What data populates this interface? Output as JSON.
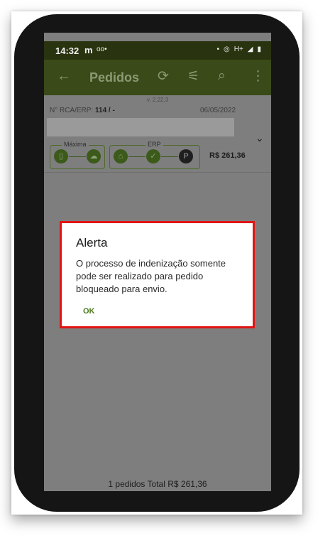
{
  "statusbar": {
    "time": "14:32",
    "carrier_icon": "m",
    "voicemail_icon": "oo•",
    "network": "H+"
  },
  "appbar": {
    "title": "Pedidos",
    "back_icon": "←",
    "sync_icon": "⟳",
    "filter_icon": "⚟",
    "search_icon": "⌕",
    "more_icon": "⋮"
  },
  "header": {
    "version": "v. 2.22.3",
    "rca_label": "N° RCA/ERP:",
    "rca_value": "114 / -",
    "date": "06/05/2022"
  },
  "pedido": {
    "group1_label": "Máxima",
    "group2_label": "ERP",
    "p_label": "P",
    "value": "R$  261,36"
  },
  "footer": {
    "text": "1 pedidos  Total R$ 261,36"
  },
  "dialog": {
    "title": "Alerta",
    "message": "O processo de indenização somente pode ser realizado para pedido bloqueado para envio.",
    "ok_label": "OK"
  },
  "colors": {
    "dialog_border": "#e01515",
    "appbar": "#3a4a18",
    "accent": "#4a7a1a"
  }
}
